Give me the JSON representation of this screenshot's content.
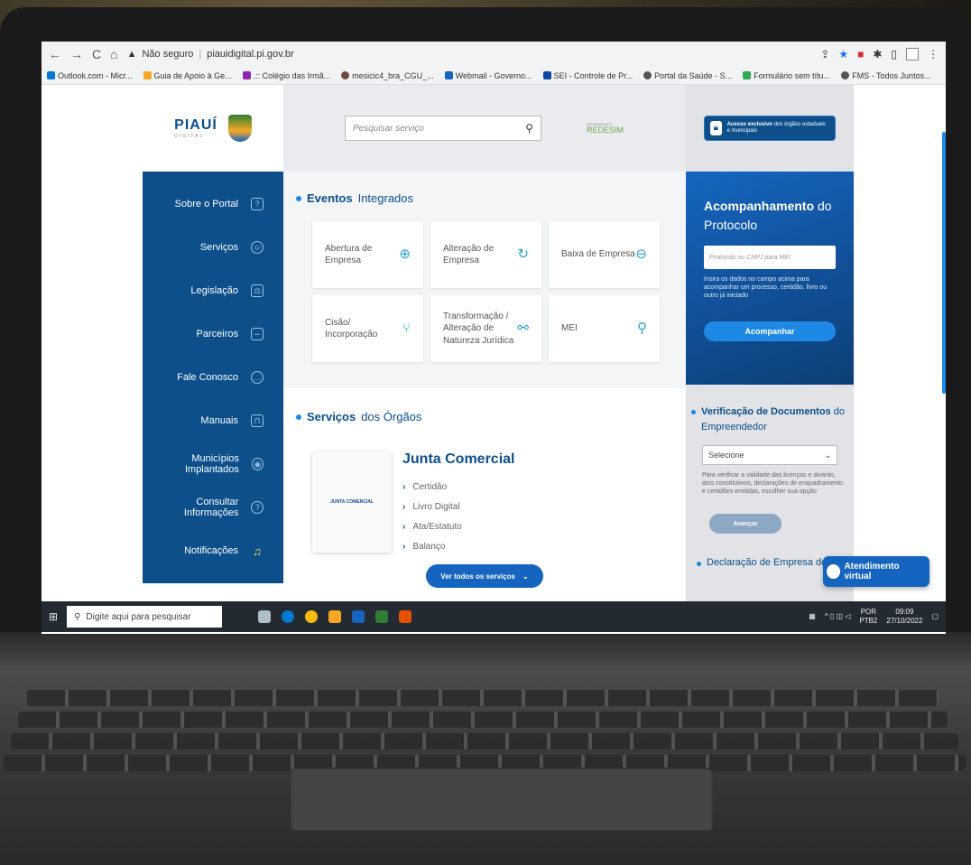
{
  "browser": {
    "security_label": "Não seguro",
    "url": "piauidigital.pi.gov.br",
    "bookmarks": [
      "Outlook.com - Micr...",
      "Guia de Apoio à Ge...",
      ".:: Colégio das Irmã...",
      "mesicic4_bra_CGU_...",
      "Webmail - Governo...",
      "SEI - Controle de Pr...",
      "Portal da Saúde - S...",
      "Formulário sem títu...",
      "FMS - Todos Juntos..."
    ]
  },
  "header": {
    "logo_text": "PIAUÍ",
    "logo_sub": "DIGITAL",
    "search_placeholder": "Pesquisar serviço",
    "redesim_label": "REDESIM",
    "redesim_small": "INTEGRADO À",
    "exclusive_bold": "Acesso exclusivo",
    "exclusive_rest": "dos órgãos estaduais e municipais"
  },
  "sidebar": {
    "items": [
      {
        "label": "Sobre o Portal"
      },
      {
        "label": "Serviços"
      },
      {
        "label": "Legislação"
      },
      {
        "label": "Parceiros"
      },
      {
        "label": "Fale Conosco"
      },
      {
        "label": "Manuais"
      },
      {
        "label": "Municípios Implantados"
      },
      {
        "label": "Consultar Informações"
      },
      {
        "label": "Notificações"
      }
    ]
  },
  "eventos": {
    "title_bold": "Eventos",
    "title_rest": "Integrados",
    "cards": [
      {
        "label": "Abertura de Empresa"
      },
      {
        "label": "Alteração de Empresa"
      },
      {
        "label": "Baixa de Empresa"
      },
      {
        "label": "Cisão/ Incorporação"
      },
      {
        "label": "Transformação / Alteração de Natureza Jurídica"
      },
      {
        "label": "MEI"
      }
    ]
  },
  "servicos": {
    "title_bold": "Serviços",
    "title_rest": "dos Órgãos",
    "junta_logo_text": "JUNTA COMERCIAL",
    "junta_title": "Junta Comercial",
    "links": [
      "Certidão",
      "Livro Digital",
      "Ata/Estatuto",
      "Balanço"
    ],
    "button": "Ver todos os serviços"
  },
  "protocolo": {
    "title_bold": "Acompanhamento",
    "title_rest": "do Protocolo",
    "input_placeholder": "Protocolo ou CNPJ para MEI",
    "help": "Insira os dados no campo acima para acompanhar um processo, certidão, livro ou outro já iniciado",
    "button": "Acompanhar"
  },
  "verificacao": {
    "title_bold": "Verificação de Documentos",
    "title_rest": "do Empreendedor",
    "select_value": "Selecione",
    "help": "Para verificar a validade das licenças e alvarás, atos constitutivos, declarações de enquadramento e certidões emitidas, escolher sua opção",
    "button": "Avançar",
    "declaracao": "Declaração de Empresa de"
  },
  "chat": {
    "label": "Atendimento virtual"
  },
  "taskbar": {
    "search": "Digite aqui para pesquisar",
    "lang1": "POR",
    "lang2": "PTB2",
    "time": "09:09",
    "date": "27/10/2022"
  }
}
